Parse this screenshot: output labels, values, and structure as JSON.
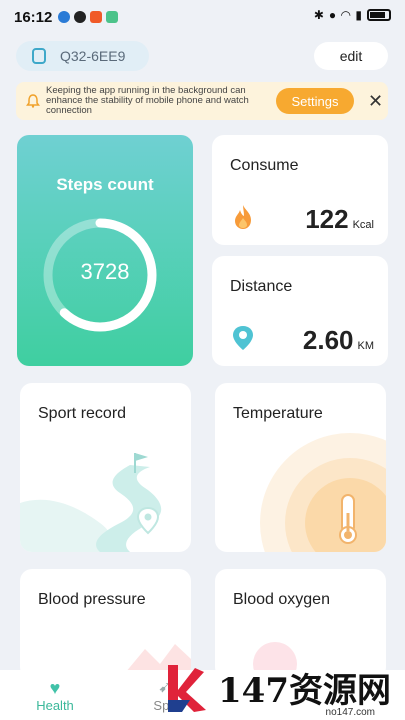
{
  "status_bar": {
    "time": "16:12"
  },
  "device": {
    "name": "Q32-6EE9",
    "edit_label": "edit"
  },
  "notice": {
    "text": "Keeping the app running in the background can enhance the stability of mobile phone and watch connection",
    "settings_label": "Settings"
  },
  "steps": {
    "title": "Steps count",
    "value": "3728",
    "progress": 0.62
  },
  "consume": {
    "title": "Consume",
    "value": "122",
    "unit": "Kcal"
  },
  "distance": {
    "title": "Distance",
    "value": "2.60",
    "unit": "KM"
  },
  "cards": {
    "sport_record": "Sport record",
    "temperature": "Temperature",
    "blood_pressure": "Blood pressure",
    "blood_oxygen": "Blood oxygen"
  },
  "nav": {
    "health": "Health",
    "sport": "Spo"
  },
  "watermark": {
    "text": "147资源网",
    "sub": "no147.com"
  },
  "colors": {
    "accent": "#3fcfa0",
    "notice_bg": "#fdf3dc",
    "settings_btn": "#f7a930",
    "background": "#eef1f6"
  },
  "icons": {
    "consume": "flame-icon",
    "distance": "location-pin-icon",
    "health_tab": "heart-icon",
    "sport_tab": "running-icon"
  }
}
